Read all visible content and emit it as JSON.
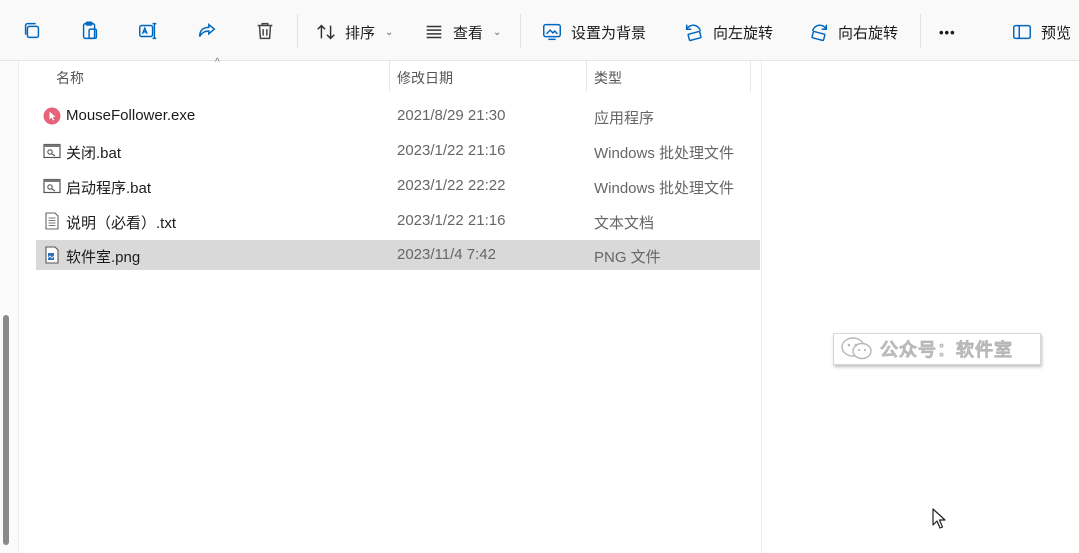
{
  "toolbar": {
    "sort_label": "排序",
    "view_label": "查看",
    "set_background_label": "设置为背景",
    "rotate_left_label": "向左旋转",
    "rotate_right_label": "向右旋转",
    "more_label": "•••",
    "preview_label": "预览"
  },
  "columns": {
    "name": "名称",
    "modified": "修改日期",
    "type": "类型"
  },
  "files": [
    {
      "name": "MouseFollower.exe",
      "modified": "2021/8/29 21:30",
      "type": "应用程序",
      "icon": "app-icon"
    },
    {
      "name": "关闭.bat",
      "modified": "2023/1/22 21:16",
      "type": "Windows 批处理文件",
      "icon": "batch-file-icon"
    },
    {
      "name": "启动程序.bat",
      "modified": "2023/1/22 22:22",
      "type": "Windows 批处理文件",
      "icon": "batch-file-icon"
    },
    {
      "name": "说明（必看）.txt",
      "modified": "2023/1/22 21:16",
      "type": "文本文档",
      "icon": "text-file-icon"
    },
    {
      "name": "软件室.png",
      "modified": "2023/11/4 7:42",
      "type": "PNG 文件",
      "icon": "image-file-icon",
      "selected": true
    }
  ],
  "watermark": "公众号：软件室",
  "colors": {
    "accent": "#0067c0",
    "selected_row": "#d9d9d9",
    "app_icon": "#e8637a"
  }
}
